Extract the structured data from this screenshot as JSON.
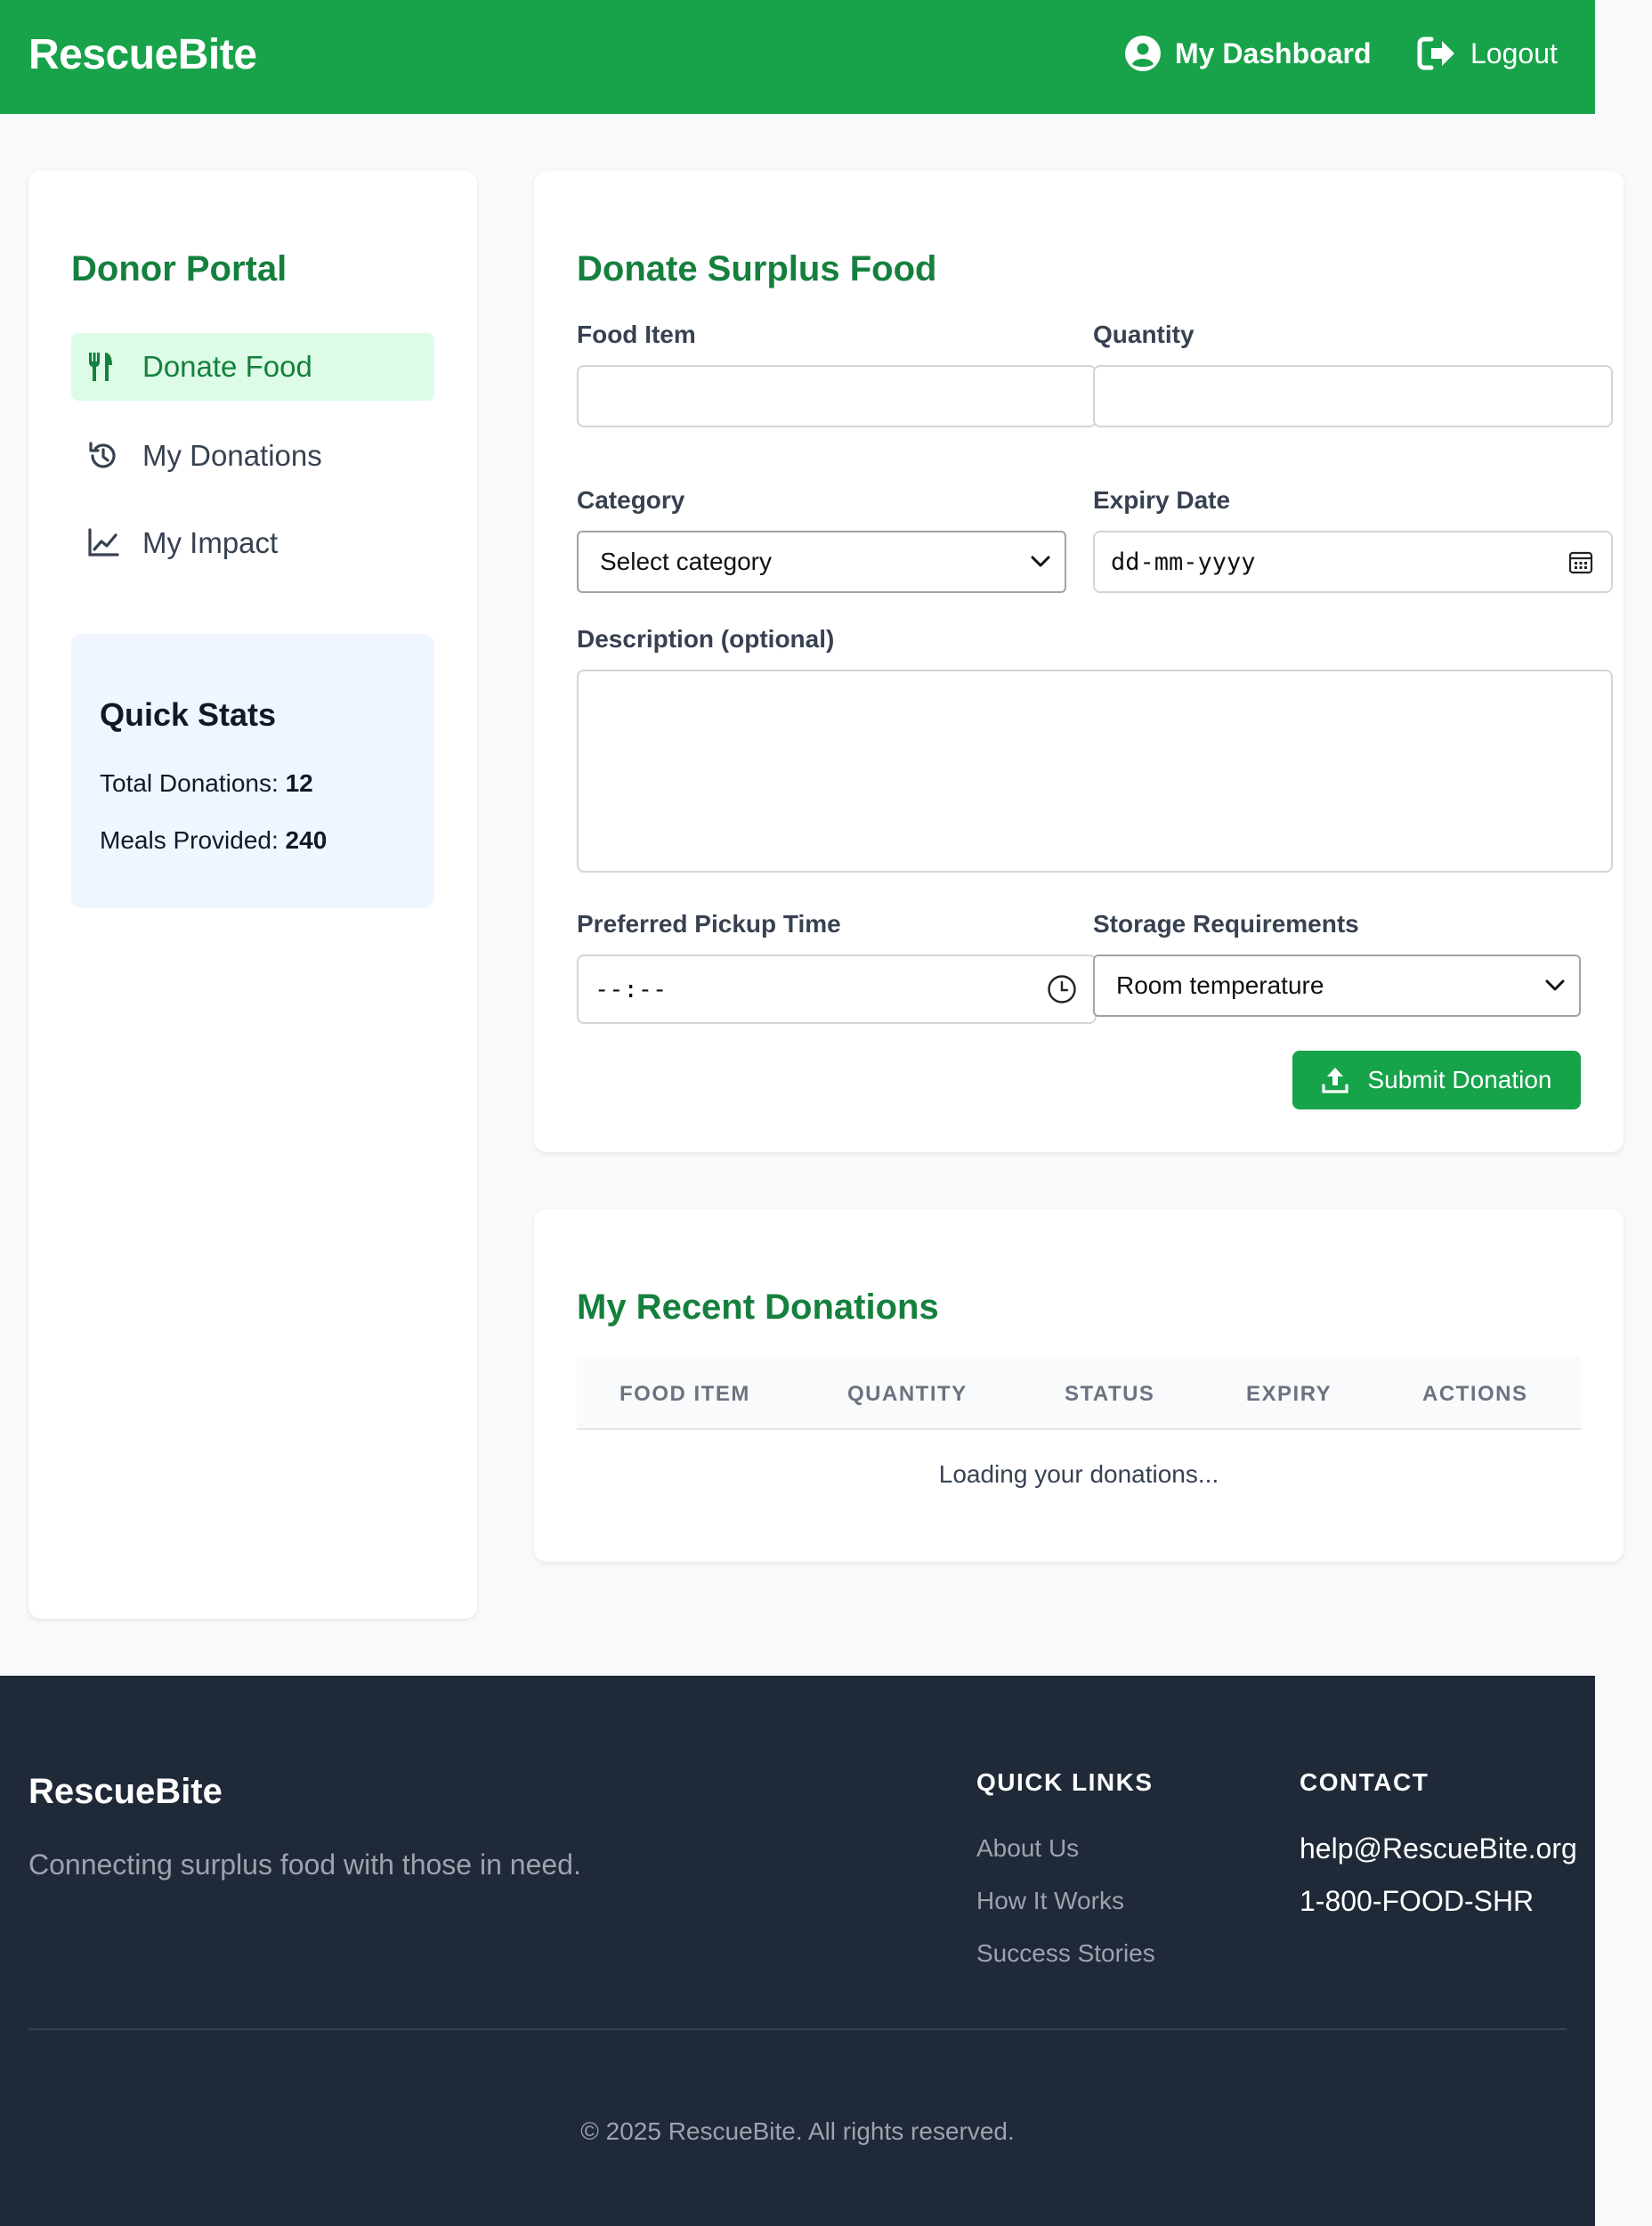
{
  "header": {
    "brand": "RescueBite",
    "dashboard_label": "My Dashboard",
    "logout_label": "Logout"
  },
  "sidebar": {
    "title": "Donor Portal",
    "items": [
      {
        "label": "Donate Food",
        "icon": "utensils-icon",
        "active": true
      },
      {
        "label": "My Donations",
        "icon": "history-icon",
        "active": false
      },
      {
        "label": "My Impact",
        "icon": "chart-line-icon",
        "active": false
      }
    ],
    "quick_stats": {
      "title": "Quick Stats",
      "total_donations_label": "Total Donations:",
      "total_donations_value": "12",
      "meals_provided_label": "Meals Provided:",
      "meals_provided_value": "240"
    }
  },
  "donate_form": {
    "title": "Donate Surplus Food",
    "food_item_label": "Food Item",
    "food_item_value": "",
    "quantity_label": "Quantity",
    "quantity_value": "",
    "category_label": "Category",
    "category_selected": "Select category",
    "expiry_label": "Expiry Date",
    "expiry_placeholder": "dd-mm-yyyy",
    "description_label": "Description (optional)",
    "description_value": "",
    "pickup_label": "Preferred Pickup Time",
    "pickup_placeholder": "--:--",
    "storage_label": "Storage Requirements",
    "storage_selected": "Room temperature",
    "submit_label": "Submit Donation"
  },
  "recent_donations": {
    "title": "My Recent Donations",
    "columns": [
      "FOOD ITEM",
      "QUANTITY",
      "STATUS",
      "EXPIRY",
      "ACTIONS"
    ],
    "loading_text": "Loading your donations..."
  },
  "footer": {
    "brand": "RescueBite",
    "tagline": "Connecting surplus food with those in need.",
    "quick_links_heading": "QUICK LINKS",
    "quick_links": [
      "About Us",
      "How It Works",
      "Success Stories"
    ],
    "contact_heading": "CONTACT",
    "email": "help@RescueBite.org",
    "phone": "1-800-FOOD-SHR",
    "copyright": "© 2025 RescueBite. All rights reserved."
  },
  "colors": {
    "brand_green": "#18a34a",
    "title_green": "#15803d",
    "active_bg": "#dcfce7",
    "stats_bg": "#eff6ff",
    "footer_bg": "#1f2937"
  }
}
